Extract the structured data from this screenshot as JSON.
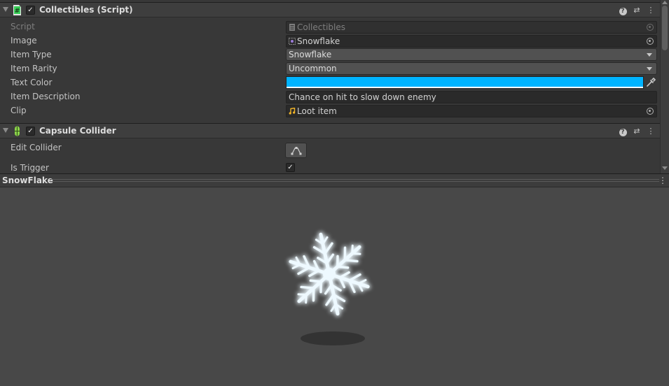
{
  "inspector": {
    "collectibles": {
      "title": "Collectibles (Script)",
      "enabled_mark": "✓",
      "fields": {
        "script": {
          "label": "Script",
          "value": "Collectibles"
        },
        "image": {
          "label": "Image",
          "value": "Snowflake"
        },
        "item_type": {
          "label": "Item Type",
          "value": "Snowflake"
        },
        "item_rarity": {
          "label": "Item Rarity",
          "value": "Uncommon"
        },
        "text_color": {
          "label": "Text Color",
          "value": "#00b4ff"
        },
        "item_description": {
          "label": "Item Description",
          "value": "Chance on hit to slow down enemy"
        },
        "clip": {
          "label": "Clip",
          "value": "Loot item"
        }
      }
    },
    "capsule_collider": {
      "title": "Capsule Collider",
      "enabled_mark": "✓",
      "fields": {
        "edit_collider": {
          "label": "Edit Collider"
        },
        "is_trigger": {
          "label": "Is Trigger",
          "mark": "✓"
        }
      }
    },
    "header_icons": {
      "help": "?",
      "preset": "⇄",
      "menu": "⋮"
    }
  },
  "preview": {
    "title": "SnowFlake",
    "menu": "⋮"
  },
  "colors": {
    "panel_bg": "#383838",
    "preview_bg": "#484848",
    "accent_color_swatch": "#00b4ff",
    "script_icon": "#3bd15a",
    "collider_icon": "#8bd34a",
    "snowflake": "#eef9ff",
    "snowflake_glow": "#d8f0ff"
  },
  "icons": [
    "fold-arrow-icon",
    "script-hash-icon",
    "capsule-collider-icon",
    "help-icon",
    "preset-icon",
    "menu-dots-icon",
    "object-picker-icon",
    "sprite-icon",
    "audio-clip-icon",
    "eyedropper-icon",
    "edit-collider-icon",
    "checkbox-icon"
  ]
}
